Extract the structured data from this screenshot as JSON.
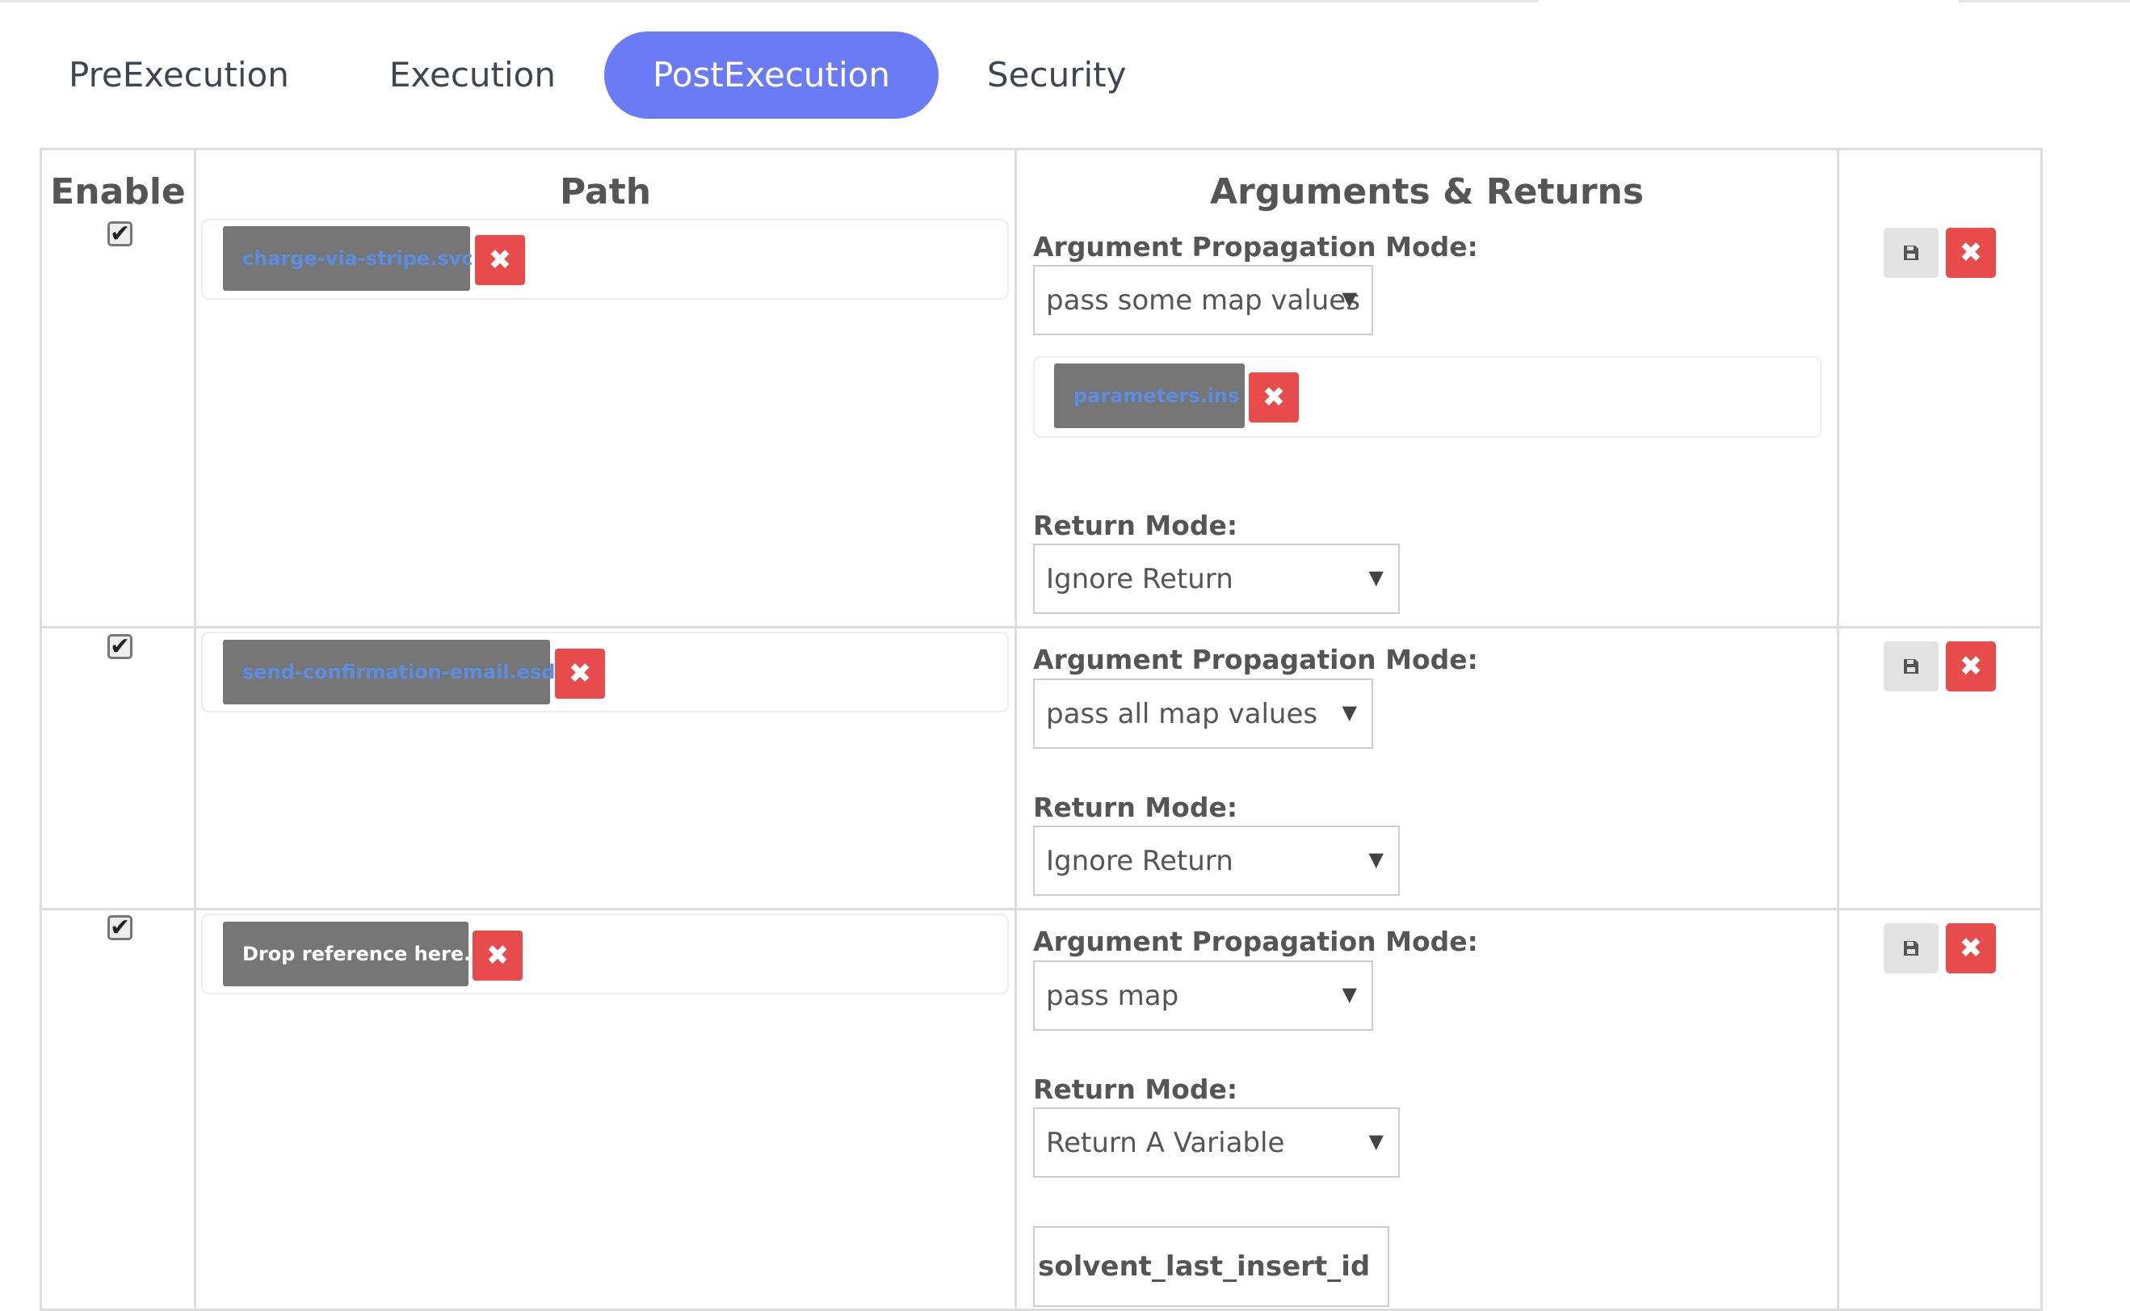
{
  "tabs": [
    {
      "label": "PreExecution",
      "active": false
    },
    {
      "label": "Execution",
      "active": false
    },
    {
      "label": "PostExecution",
      "active": true
    },
    {
      "label": "Security",
      "active": false
    }
  ],
  "table": {
    "headers": {
      "enable": "Enable",
      "path": "Path",
      "args": "Arguments & Returns"
    },
    "rows": [
      {
        "enabled": true,
        "path": "charge-via-stripe.svc",
        "arg_label": "Argument Propagation Mode:",
        "arg_mode": "pass some map values",
        "map_values": [
          "parameters.ins"
        ],
        "return_label": "Return Mode:",
        "return_mode": "Ignore Return"
      },
      {
        "enabled": true,
        "path": "send-confirmation-email.esd",
        "arg_label": "Argument Propagation Mode:",
        "arg_mode": "pass all map values",
        "return_label": "Return Mode:",
        "return_mode": "Ignore Return"
      },
      {
        "enabled": true,
        "path": "Drop reference here.",
        "arg_label": "Argument Propagation Mode:",
        "arg_mode": "pass map",
        "return_label": "Return Mode:",
        "return_mode": "Return A Variable",
        "return_variable": "solvent_last_insert_id"
      }
    ]
  },
  "icons": {
    "remove": "close-icon",
    "save": "save-icon",
    "dropdown": "caret-down-icon",
    "check": "checkmark-icon"
  },
  "colors": {
    "active_tab": "#6b7bf5",
    "danger": "#e84b4b",
    "tag_bg": "#767676",
    "tag_text": "#5b8de0"
  }
}
